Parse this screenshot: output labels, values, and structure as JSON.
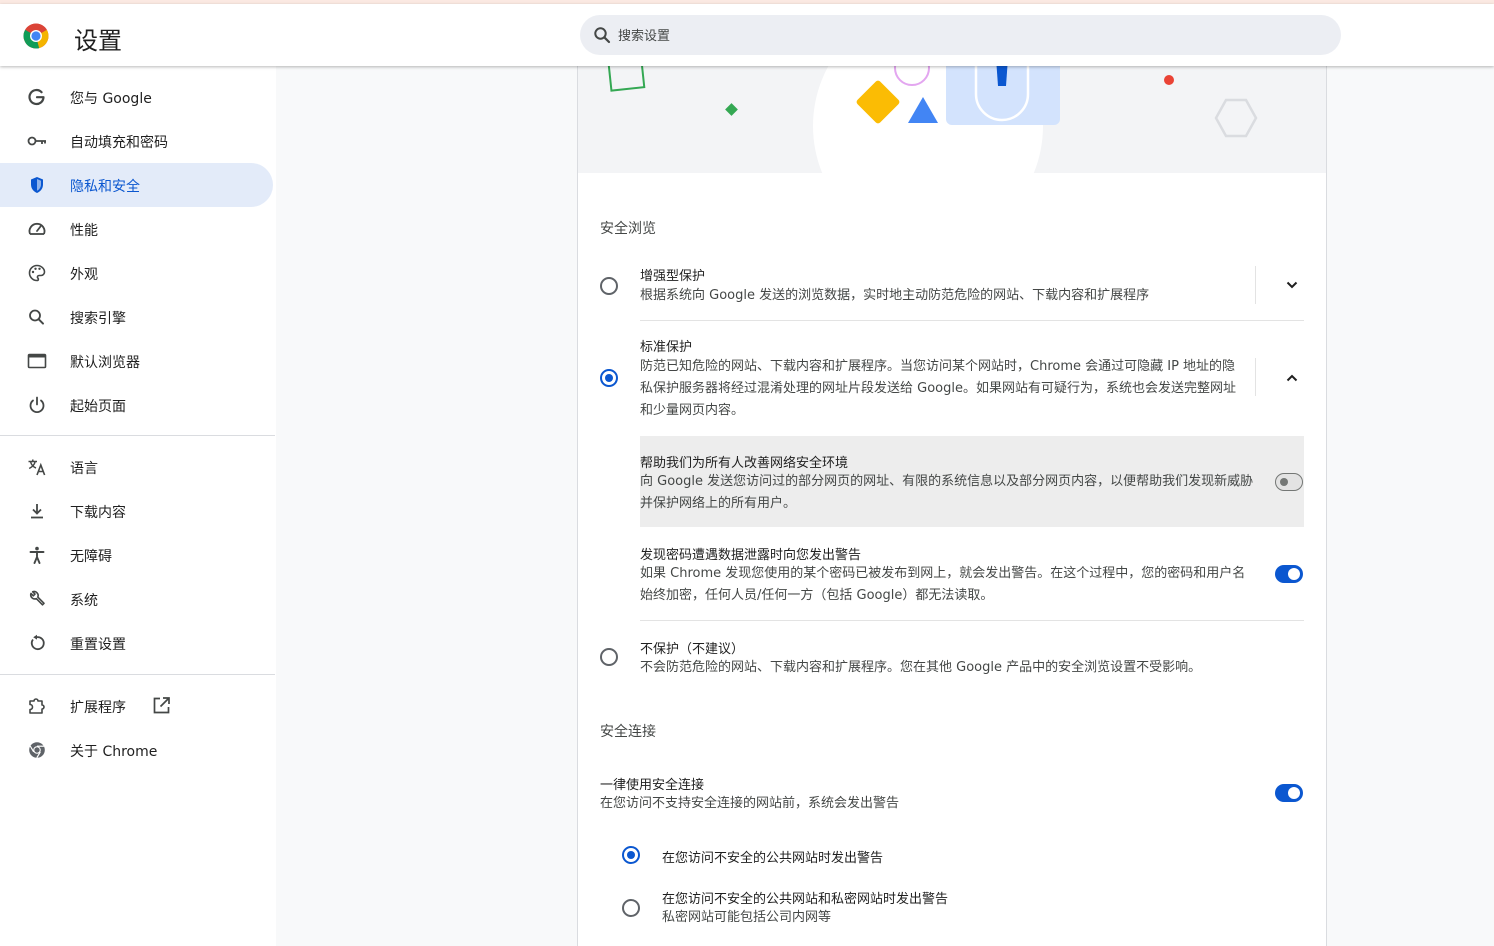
{
  "window": {
    "title": "设置"
  },
  "search": {
    "placeholder": "搜索设置"
  },
  "sidebar": {
    "items": [
      {
        "label": "您与 Google",
        "icon": "google-g-icon"
      },
      {
        "label": "自动填充和密码",
        "icon": "key-icon"
      },
      {
        "label": "隐私和安全",
        "icon": "shield-icon",
        "active": true
      },
      {
        "label": "性能",
        "icon": "speedometer-icon"
      },
      {
        "label": "外观",
        "icon": "palette-icon"
      },
      {
        "label": "搜索引擎",
        "icon": "search-icon"
      },
      {
        "label": "默认浏览器",
        "icon": "browser-window-icon"
      },
      {
        "label": "起始页面",
        "icon": "power-icon"
      },
      {
        "label": "语言",
        "icon": "translate-icon"
      },
      {
        "label": "下载内容",
        "icon": "download-icon"
      },
      {
        "label": "无障碍",
        "icon": "accessibility-icon"
      },
      {
        "label": "系统",
        "icon": "wrench-icon"
      },
      {
        "label": "重置设置",
        "icon": "reset-icon"
      },
      {
        "label": "扩展程序",
        "icon": "puzzle-icon",
        "external_icon": "open-in-new-icon"
      },
      {
        "label": "关于 Chrome",
        "icon": "chrome-icon"
      }
    ]
  },
  "safe_browsing": {
    "title": "安全浏览",
    "enhanced": {
      "title": "增强型保护",
      "desc": "根据系统向 Google 发送的浏览数据，实时地主动防范危险的网站、下载内容和扩展程序",
      "selected": false,
      "expanded": false
    },
    "standard": {
      "title": "标准保护",
      "desc": "防范已知危险的网站、下载内容和扩展程序。当您访问某个网站时，Chrome 会通过可隐藏 IP 地址的隐私保护服务器将经过混淆处理的网址片段发送给 Google。如果网站有可疑行为，系统也会发送完整网址和少量网页内容。",
      "selected": true,
      "expanded": true,
      "help_improve": {
        "title": "帮助我们为所有人改善网络安全环境",
        "desc": "向 Google 发送您访问过的部分网页的网址、有限的系统信息以及部分网页内容，以便帮助我们发现新威胁并保护网络上的所有用户。",
        "enabled": false
      },
      "password_leak": {
        "title": "发现密码遭遇数据泄露时向您发出警告",
        "desc": "如果 Chrome 发现您使用的某个密码已被发布到网上，就会发出警告。在这个过程中，您的密码和用户名始终加密，任何人员/任何一方（包括 Google）都无法读取。",
        "enabled": true
      }
    },
    "none": {
      "title": "不保护（不建议）",
      "desc": "不会防范危险的网站、下载内容和扩展程序。您在其他 Google 产品中的安全浏览设置不受影响。",
      "selected": false
    }
  },
  "secure_connections": {
    "title": "安全连接",
    "always_https": {
      "title": "一律使用安全连接",
      "desc": "在您访问不支持安全连接的网站前，系统会发出警告",
      "enabled": true
    },
    "options": [
      {
        "title": "在您访问不安全的公共网站时发出警告",
        "desc": "",
        "selected": true
      },
      {
        "title": "在您访问不安全的公共网站和私密网站时发出警告",
        "desc": "私密网站可能包括公司内网等",
        "selected": false
      }
    ]
  },
  "colors": {
    "accent": "#0b57d0",
    "active_bg": "#e3ebf9",
    "page_bg": "#f8f9fa"
  }
}
